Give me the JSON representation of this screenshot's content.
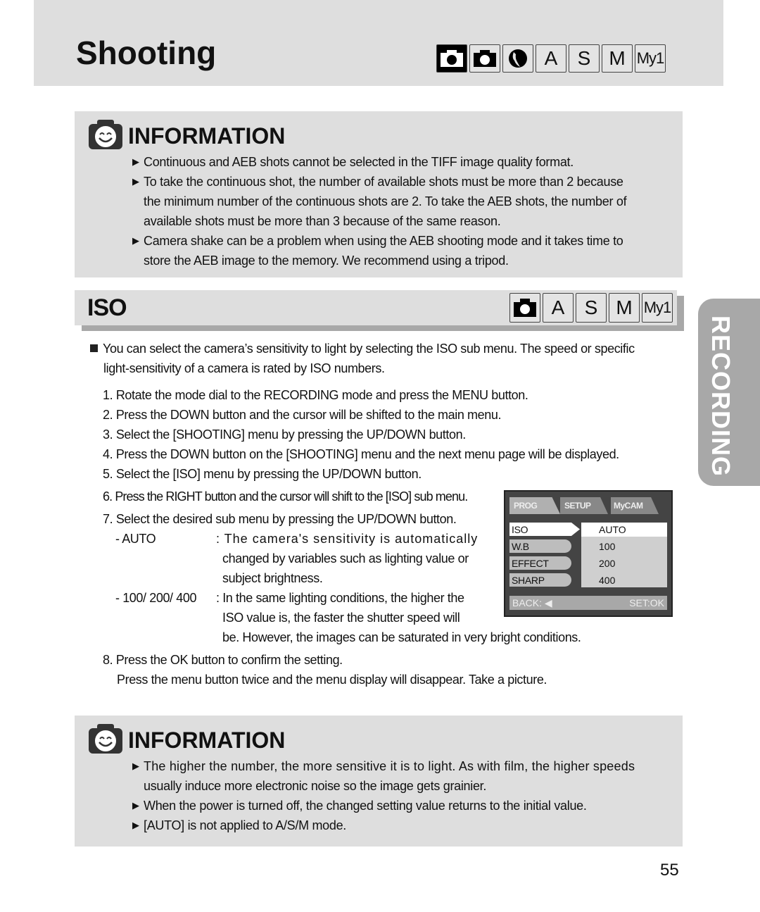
{
  "header": {
    "title": "Shooting",
    "modes": [
      {
        "icon": "auto-camera-icon",
        "label": ""
      },
      {
        "icon": "program-camera-icon",
        "label": ""
      },
      {
        "icon": "portrait-scene-icon",
        "label": ""
      },
      {
        "icon": "",
        "label": "A"
      },
      {
        "icon": "",
        "label": "S"
      },
      {
        "icon": "",
        "label": "M"
      },
      {
        "icon": "",
        "label": "My1"
      }
    ]
  },
  "info1": {
    "title": "INFORMATION",
    "bullet": "▶",
    "items": [
      "Continuous and AEB shots cannot be selected in the TIFF image quality format.",
      [
        "To take the continuous shot, the number of available shots must be more than 2 because",
        "the minimum number of the continuous shots are 2. To take the AEB shots, the number of",
        "available shots must be more than 3 because of the same reason."
      ],
      [
        "Camera shake can be a problem when using the AEB shooting mode and it takes time to",
        "store the AEB image to the memory. We recommend using a tripod."
      ]
    ]
  },
  "iso_section": {
    "title": "ISO",
    "modes": [
      {
        "icon": "program-camera-icon",
        "label": ""
      },
      {
        "icon": "",
        "label": "A"
      },
      {
        "icon": "",
        "label": "S"
      },
      {
        "icon": "",
        "label": "M"
      },
      {
        "icon": "",
        "label": "My1"
      }
    ],
    "intro_line1": "You can select the camera’s sensitivity to light by selecting the ISO sub menu. The speed or specific",
    "intro_line2": "light-sensitivity of a camera is rated by ISO numbers.",
    "steps": [
      "1. Rotate the mode dial to the RECORDING mode and press the MENU button.",
      "2. Press the DOWN button and the cursor will be shifted to the main menu.",
      "3. Select the [SHOOTING] menu by pressing the UP/DOWN button.",
      "4. Press the DOWN button on the [SHOOTING] menu and the next menu page will be displayed.",
      "5. Select the [ISO] menu by pressing the UP/DOWN button.",
      "6. Press the RIGHT button and the cursor will shift to the [ISO] sub menu.",
      "7. Select the desired sub menu by pressing the UP/DOWN button."
    ],
    "options": [
      {
        "label": "- AUTO",
        "desc": [
          ": The camera's sensitivity is automatically",
          "changed by variables such as lighting value or",
          "subject brightness."
        ]
      },
      {
        "label": "- 100/ 200/ 400",
        "desc": [
          ": In the same lighting conditions, the higher the",
          "ISO value is, the faster the shutter speed will",
          "be. However, the images can be saturated in very bright conditions."
        ]
      }
    ],
    "step8": "8. Press the OK button to confirm the setting.",
    "step8_note": "Press the menu button twice and the menu display will disappear. Take a picture."
  },
  "camera_menu": {
    "tabs": [
      "PROG",
      "SETUP",
      "MyCAM"
    ],
    "menu_items": [
      "ISO",
      "W.B",
      "EFFECT",
      "SHARP"
    ],
    "selected_menu": "ISO",
    "sub_items": [
      "AUTO",
      "100",
      "200",
      "400"
    ],
    "selected_sub": "AUTO",
    "back_label": "BACK: ◀",
    "set_label": "SET:OK"
  },
  "info2": {
    "title": "INFORMATION",
    "bullet": "▶",
    "items": [
      [
        "The higher the number, the more sensitive it is to light. As with film, the higher speeds",
        "usually induce more electronic noise so the image gets grainier."
      ],
      "When the power is turned off, the changed setting value returns to the initial value.",
      "[AUTO] is not applied to A/S/M mode."
    ]
  },
  "side_tab": {
    "label": "RECORDING"
  },
  "page_number": "55",
  "colors": {
    "panel_gray": "#dedede",
    "side_tab_gray": "#a8a8a8",
    "screen_dark": "#444444"
  }
}
